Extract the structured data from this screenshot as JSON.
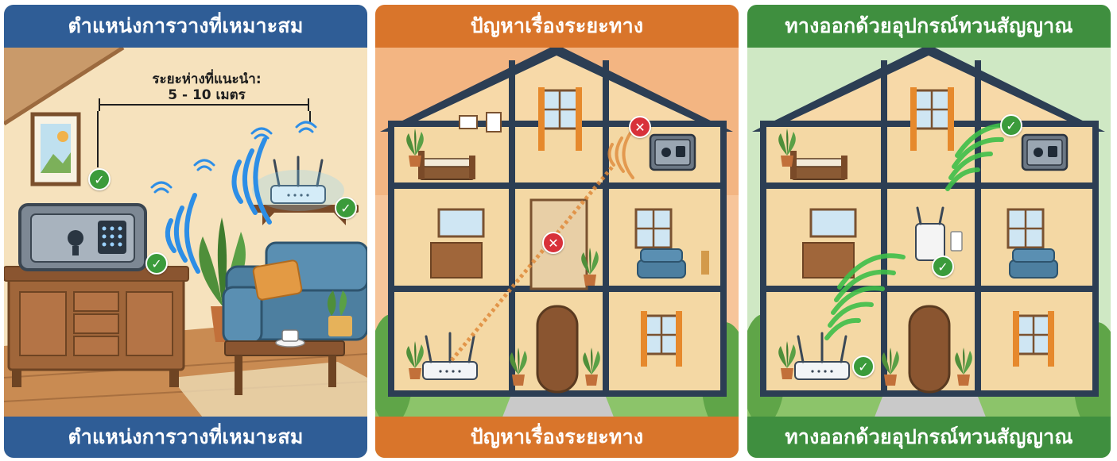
{
  "panels": [
    {
      "title": "ตำแหน่งการวางที่เหมาะสม",
      "footer": "ตำแหน่งการวางที่เหมาะสม",
      "distance_label": "ระยะห่างที่แนะนำ:",
      "distance_value": "5 - 10 เมตร",
      "accent": "#2f5d96"
    },
    {
      "title": "ปัญหาเรื่องระยะทาง",
      "footer": "ปัญหาเรื่องระยะทาง",
      "accent": "#d9752b"
    },
    {
      "title": "ทางออกด้วยอุปกรณ์ทวนสัญญาณ",
      "footer": "ทางออกด้วยอุปกรณ์ทวนสัญญาณ",
      "accent": "#3f8f3f"
    }
  ],
  "badges": {
    "ok_symbol": "✓",
    "bad_symbol": "✕"
  },
  "icons": [
    "router-icon",
    "safe-icon",
    "wifi-signal-icon",
    "check-icon",
    "cross-icon",
    "extender-icon"
  ]
}
